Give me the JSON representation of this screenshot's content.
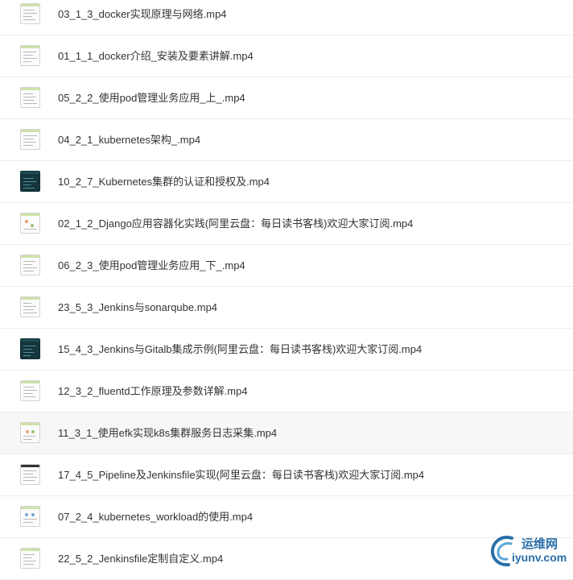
{
  "files": [
    {
      "name": "03_1_3_docker实现原理与网络.mp4",
      "thumb": "light"
    },
    {
      "name": "01_1_1_docker介绍_安装及要素讲解.mp4",
      "thumb": "light"
    },
    {
      "name": "05_2_2_使用pod管理业务应用_上_.mp4",
      "thumb": "light"
    },
    {
      "name": "04_2_1_kubernetes架构_.mp4",
      "thumb": "light"
    },
    {
      "name": "10_2_7_Kubernetes集群的认证和授权及.mp4",
      "thumb": "dark"
    },
    {
      "name": "02_1_2_Django应用容器化实践(阿里云盘：每日读书客栈)欢迎大家订阅.mp4",
      "thumb": "light"
    },
    {
      "name": "06_2_3_使用pod管理业务应用_下_.mp4",
      "thumb": "light"
    },
    {
      "name": "23_5_3_Jenkins与sonarqube.mp4",
      "thumb": "light"
    },
    {
      "name": "15_4_3_Jenkins与Gitalb集成示例(阿里云盘：每日读书客栈)欢迎大家订阅.mp4",
      "thumb": "dark"
    },
    {
      "name": "12_3_2_fluentd工作原理及参数详解.mp4",
      "thumb": "light"
    },
    {
      "name": "11_3_1_使用efk实现k8s集群服务日志采集.mp4",
      "thumb": "light"
    },
    {
      "name": "17_4_5_Pipeline及Jenkinsfile实现(阿里云盘：每日读书客栈)欢迎大家订阅.mp4",
      "thumb": "light"
    },
    {
      "name": "07_2_4_kubernetes_workload的使用.mp4",
      "thumb": "light"
    },
    {
      "name": "22_5_2_Jenkinsfile定制自定义.mp4",
      "thumb": "light"
    }
  ],
  "highlighted_index": 10,
  "watermark": {
    "cn": "运维网",
    "en": "iyunv.com"
  },
  "colors": {
    "text": "#333333",
    "divider": "#ececec",
    "highlight": "#f7f7f7",
    "watermark": "#2a6fa8"
  }
}
